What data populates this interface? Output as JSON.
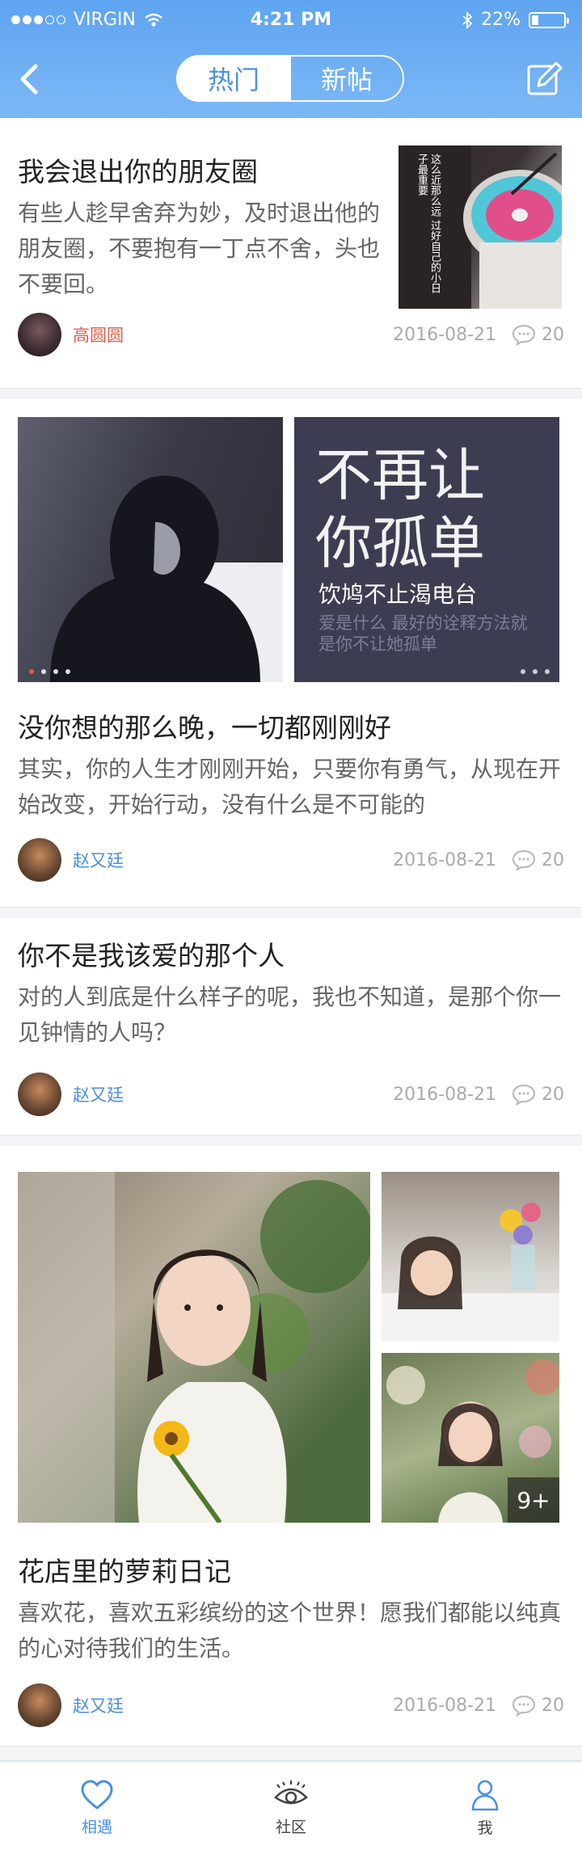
{
  "status_bar": {
    "carrier": "VIRGIN",
    "time": "4:21 PM",
    "battery": "22%",
    "battery_level": 0.22
  },
  "nav": {
    "segments": [
      "热门",
      "新帖"
    ],
    "active_segment": "热门"
  },
  "posts": [
    {
      "title": "我会退出你的朋友圈",
      "body": "有些人趁早舍弃为妙，及时退出他的朋友圈，不要抱有一丁点不舍，头也不要回。",
      "author": "高圆圆",
      "author_color": "#e25b4a",
      "date": "2016-08-21",
      "comments": "20",
      "thumb_text": "这么近那么远 过好自己的小日子最重要"
    },
    {
      "title": "没你想的那么晚，一切都刚刚好",
      "body": "其实，你的人生才刚刚开始，只要你有勇气，从现在开始改变，开始行动，没有什么是不可能的",
      "author": "赵又廷",
      "author_color": "#4a90e2",
      "date": "2016-08-21",
      "comments": "20",
      "banner_title": "不再让你孤单",
      "banner_subtitle": "饮鸠不止渴电台",
      "banner_caption": "爱是什么 最好的诠释方法就是你不让她孤单"
    },
    {
      "title": "你不是我该爱的那个人",
      "body": "对的人到底是什么样子的呢，我也不知道，是那个你一见钟情的人吗？",
      "author": "赵又廷",
      "author_color": "#4a90e2",
      "date": "2016-08-21",
      "comments": "20"
    },
    {
      "title": "花店里的萝莉日记",
      "body": "喜欢花，喜欢五彩缤纷的这个世界！愿我们都能以纯真的心对待我们的生活。",
      "author": "赵又廷",
      "author_color": "#4a90e2",
      "date": "2016-08-21",
      "comments": "20",
      "more_photos": "9+"
    }
  ],
  "tabbar": {
    "tabs": [
      "相遇",
      "社区",
      "我"
    ],
    "active": "相遇"
  },
  "colors": {
    "accent": "#4a90e2",
    "header_bg": "#6aacf3"
  }
}
